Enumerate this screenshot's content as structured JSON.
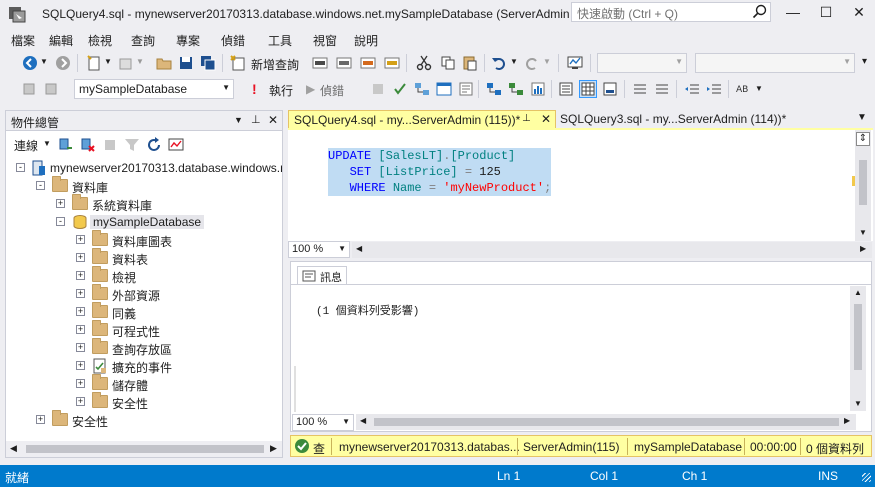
{
  "window": {
    "title": "SQLQuery4.sql - mynewserver20170313.database.windows.net.mySampleDatabase (ServerAdmin (...",
    "quick_launch_placeholder": "快速啟動 (Ctrl + Q)"
  },
  "menu": [
    "檔案",
    "編輯",
    "檢視",
    "查詢",
    "專案",
    "偵錯",
    "工具",
    "視窗",
    "說明"
  ],
  "toolbar": {
    "new_query_label": "新增查詢",
    "database_selected": "mySampleDatabase",
    "execute_label": "執行",
    "debug_label": "偵錯"
  },
  "object_explorer": {
    "title": "物件總管",
    "connect_label": "連線",
    "tree": [
      {
        "label": "mynewserver20170313.database.windows.n",
        "level": 0,
        "expander": "-",
        "icon": "server-icon"
      },
      {
        "label": "資料庫",
        "level": 1,
        "expander": "-",
        "icon": "folder-icon"
      },
      {
        "label": "系統資料庫",
        "level": 2,
        "expander": "+",
        "icon": "folder-icon"
      },
      {
        "label": "mySampleDatabase",
        "level": 2,
        "expander": "-",
        "icon": "database-icon"
      },
      {
        "label": "資料庫圖表",
        "level": 3,
        "expander": "+",
        "icon": "folder-icon"
      },
      {
        "label": "資料表",
        "level": 3,
        "expander": "+",
        "icon": "folder-icon"
      },
      {
        "label": "檢視",
        "level": 3,
        "expander": "+",
        "icon": "folder-icon"
      },
      {
        "label": "外部資源",
        "level": 3,
        "expander": "+",
        "icon": "folder-icon"
      },
      {
        "label": "同義",
        "level": 3,
        "expander": "+",
        "icon": "folder-icon"
      },
      {
        "label": "可程式性",
        "level": 3,
        "expander": "+",
        "icon": "folder-icon"
      },
      {
        "label": "查詢存放區",
        "level": 3,
        "expander": "+",
        "icon": "folder-icon"
      },
      {
        "label": "擴充的事件",
        "level": 3,
        "expander": "+",
        "icon": "extended-events-icon"
      },
      {
        "label": "儲存體",
        "level": 3,
        "expander": "+",
        "icon": "folder-icon"
      },
      {
        "label": "安全性",
        "level": 3,
        "expander": "+",
        "icon": "folder-icon"
      },
      {
        "label": "安全性",
        "level": 1,
        "expander": "+",
        "icon": "folder-icon"
      }
    ]
  },
  "tabs": {
    "active": "SQLQuery4.sql - my...ServerAdmin (115))*",
    "inactive": "SQLQuery3.sql - my...ServerAdmin (114))*"
  },
  "editor": {
    "lines": [
      {
        "kw": "UPDATE",
        "rest_id1": "[SalesLT]",
        "dot": ".",
        "rest_id2": "[Product]"
      },
      {
        "kw": "SET",
        "id": "[ListPrice]",
        "op": "=",
        "val": "125"
      },
      {
        "kw": "WHERE",
        "id": "Name",
        "op": "=",
        "str": "'myNewProduct'",
        "end": ";"
      }
    ],
    "zoom": "100 %"
  },
  "results": {
    "tab_label": "訊息",
    "message": "(1 個資料列受影響)",
    "zoom": "100 %"
  },
  "query_status": {
    "state": "查",
    "server": "mynewserver20170313.databas...",
    "user": "ServerAdmin(115)",
    "database": "mySampleDatabase",
    "elapsed": "00:00:00",
    "rows": "0 個資料列"
  },
  "statusbar": {
    "ready": "就緒",
    "ln": "Ln 1",
    "col": "Col 1",
    "ch": "Ch 1",
    "ins": "INS"
  },
  "colors": {
    "accent": "#007acc",
    "tab_active": "#ffffa2",
    "selection": "#c0dcf3"
  }
}
